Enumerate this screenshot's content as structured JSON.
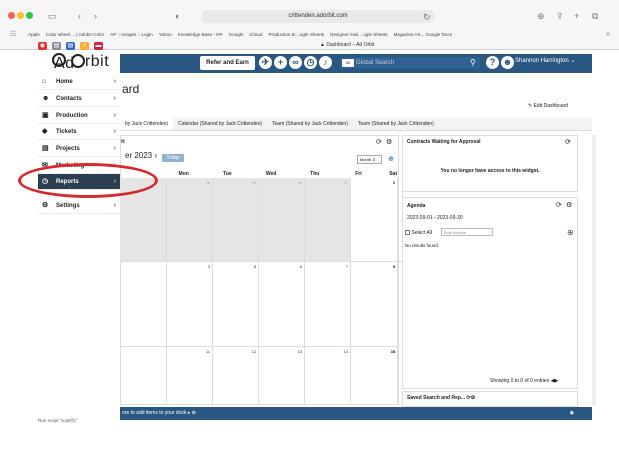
{
  "browser": {
    "url": "crittenden.adorbit.com",
    "tab_title": "Dashboard – Ad Orbit",
    "bookmarks": [
      "Apple",
      "Color wheel, ...| Adobe Color",
      "AP :: Images :: Login",
      "Yahoo",
      "Knowledge Base - KR",
      "Google",
      "iCloud",
      "Production B....ogle Sheets",
      "Designer Assi....ogle Sheets",
      "Magazine Art... Google Docs"
    ]
  },
  "app": {
    "logo_text_1": "Ad",
    "logo_text_2": "rbit",
    "refer_label": "Refer and Earn",
    "search_scope": "All",
    "search_placeholder": "Global Search",
    "user_name": "Shannon Harrington",
    "page_title": "ard",
    "edit_dashboard": "Edit Dashboard"
  },
  "sidebar": {
    "items": [
      {
        "label": "Home",
        "icon": "home-icon"
      },
      {
        "label": "Contacts",
        "icon": "people-icon"
      },
      {
        "label": "Production",
        "icon": "production-icon"
      },
      {
        "label": "Tickets",
        "icon": "ticket-icon"
      },
      {
        "label": "Projects",
        "icon": "clipboard-icon"
      },
      {
        "label": "Marketing",
        "icon": "mail-icon"
      },
      {
        "label": "Reports",
        "icon": "reports-icon"
      },
      {
        "label": "Settings",
        "icon": "gear-icon"
      }
    ]
  },
  "widget_tabs": [
    "by Jack Crittenden)",
    "Calendar (Shared by Jack Crittenden)",
    "Team (Shared by Jack Crittenden)",
    "Team (Shared by Jack Crittenden)"
  ],
  "calendar": {
    "header_n": "n",
    "month_label": "er 2023",
    "nav_next": "›",
    "today": "Today",
    "view": "Month",
    "days": [
      "Mon",
      "Tue",
      "Wed",
      "Thu",
      "Fri",
      "Sat"
    ],
    "row1": [
      "28",
      "29",
      "30",
      "31",
      "1",
      "2"
    ],
    "row2": [
      "4",
      "5",
      "6",
      "7",
      "8",
      "9"
    ],
    "row3": [
      "11",
      "12",
      "13",
      "14",
      "15",
      "16"
    ]
  },
  "contracts": {
    "title": "Contracts Waiting for Approval",
    "message": "You no longer have access to this widget."
  },
  "agenda": {
    "title": "Agenda",
    "range": "2023-09-01 - 2023-09-30",
    "select_all": "Select All",
    "bulk": "Bulk Actions",
    "empty": "No results found.",
    "footer": "Showing 0 to 0 of 0 entries"
  },
  "saved": {
    "title": "Saved Search and Rep..."
  },
  "dock": {
    "text": "ore to add items to your dock"
  },
  "status": "Run script \"void(0);\""
}
